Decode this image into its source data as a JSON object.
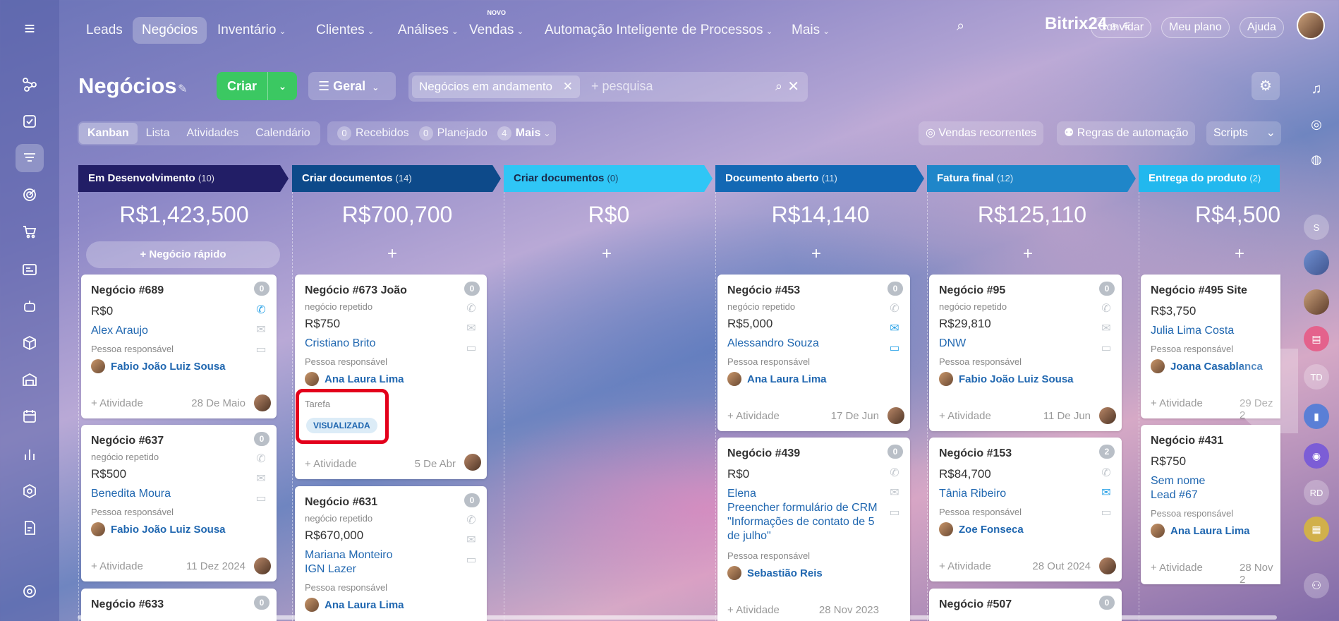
{
  "nav": {
    "items": [
      {
        "label": "Leads",
        "x": 0
      },
      {
        "label": "Negócios",
        "active": true
      },
      {
        "label": "Inventário",
        "dropdown": true
      },
      {
        "label": "Clientes",
        "dropdown": true
      },
      {
        "label": "Análises",
        "dropdown": true
      },
      {
        "label": "Vendas",
        "dropdown": true,
        "badge": "NOVO"
      },
      {
        "label": "Automação Inteligente de Processos",
        "dropdown": true
      },
      {
        "label": "Mais",
        "dropdown": true
      }
    ],
    "brand": "Bitrix24",
    "invite": "Convidar",
    "plan": "Meu plano",
    "help": "Ajuda"
  },
  "header": {
    "title": "Negócios",
    "create": "Criar",
    "general": "Geral",
    "filter_tag": "Negócios em andamento",
    "search_placeholder": "+ pesquisa"
  },
  "views": [
    "Kanban",
    "Lista",
    "Atividades",
    "Calendário"
  ],
  "counters": [
    {
      "count": "0",
      "label": "Recebidos"
    },
    {
      "count": "0",
      "label": "Planejado"
    },
    {
      "count": "4",
      "label": "Mais"
    }
  ],
  "actions": {
    "recurring": "Vendas recorrentes",
    "automation": "Regras de automação",
    "scripts": "Scripts"
  },
  "colors": {
    "create": "#3bc862",
    "link": "#2067b0",
    "highlight": "#e3001b"
  },
  "columns": [
    {
      "name": "Em Desenvolvimento",
      "count": "(10)",
      "sum": "R$1,423,500",
      "color": "#221e66",
      "quick_add": "+ Negócio rápido"
    },
    {
      "name": "Criar documentos",
      "count": "(14)",
      "sum": "R$700,700",
      "color": "#0d4a8a"
    },
    {
      "name": "Criar documentos",
      "count": "(0)",
      "sum": "R$0",
      "color": "#2fc6f6"
    },
    {
      "name": "Documento aberto",
      "count": "(11)",
      "sum": "R$14,140",
      "color": "#1368b4"
    },
    {
      "name": "Fatura final",
      "count": "(12)",
      "sum": "R$125,110",
      "color": "#1f86c9"
    },
    {
      "name": "Entrega do produto",
      "count": "(2)",
      "sum": "R$4,500",
      "color": "#22b8ee"
    }
  ],
  "plus": "+",
  "labels": {
    "responsible": "Pessoa responsável",
    "activity": "+ Atividade",
    "repeat": "negócio repetido"
  },
  "cards": {
    "c689": {
      "title": "Negócio #689",
      "badge": "0",
      "price": "R$0",
      "client": "Alex Araujo",
      "person": "Fabio João Luiz Sousa",
      "date": "28 De Maio"
    },
    "c637": {
      "title": "Negócio #637",
      "badge": "0",
      "price": "R$500",
      "client": "Benedita Moura",
      "person": "Fabio João Luiz Sousa",
      "date": "11 Dez 2024"
    },
    "c633": {
      "title": "Negócio #633",
      "badge": "0"
    },
    "c673": {
      "title": "Negócio #673 João",
      "badge": "0",
      "price": "R$750",
      "client": "Cristiano Brito",
      "person": "Ana Laura Lima",
      "task": "Tarefa",
      "task_status": "VISUALIZADA",
      "date": "5 De Abr"
    },
    "c631": {
      "title": "Negócio #631",
      "badge": "0",
      "price": "R$670,000",
      "client": "Mariana Monteiro",
      "client2": "IGN Lazer",
      "person": "Ana Laura Lima"
    },
    "c453": {
      "title": "Negócio #453",
      "badge": "0",
      "price": "R$5,000",
      "client": "Alessandro Souza",
      "person": "Ana Laura Lima",
      "date": "17 De Jun"
    },
    "c439": {
      "title": "Negócio #439",
      "badge": "0",
      "price": "R$0",
      "client": "Elena",
      "client2": "Preencher formulário de CRM \"Informações de contato de 5 de julho\"",
      "person": "Sebastião Reis",
      "date": "28 Nov 2023"
    },
    "c95": {
      "title": "Negócio #95",
      "badge": "0",
      "price": "R$29,810",
      "client": "DNW",
      "person": "Fabio João Luiz Sousa",
      "date": "11 De Jun"
    },
    "c153": {
      "title": "Negócio #153",
      "badge": "2",
      "price": "R$84,700",
      "client": "Tânia Ribeiro",
      "person": "Zoe Fonseca",
      "date": "28 Out 2024"
    },
    "c507": {
      "title": "Negócio #507",
      "badge": "0"
    },
    "c495": {
      "title": "Negócio #495 Site",
      "price": "R$3,750",
      "client": "Julia Lima Costa",
      "person": "Joana Casablanca",
      "date": "29 Dez 2"
    },
    "c431": {
      "title": "Negócio #431",
      "price": "R$750",
      "client": "Sem nome",
      "client2": "Lead #67",
      "person": "Ana Laura Lima",
      "date": "28 Nov 2"
    }
  },
  "right_rail": [
    "S",
    "TD",
    "RD"
  ]
}
